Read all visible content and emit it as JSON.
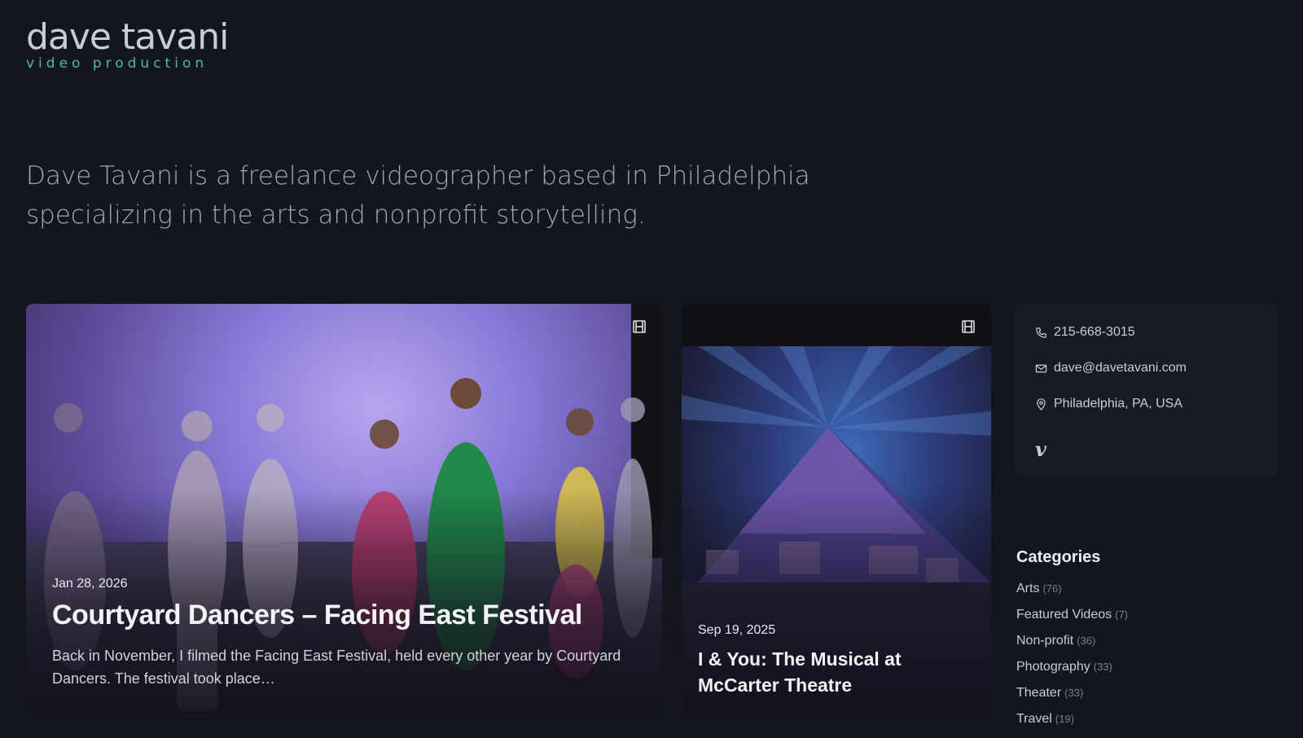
{
  "site": {
    "logo_name": "dave tavani",
    "logo_tagline": "video production"
  },
  "intro": {
    "text": "Dave Tavani is a freelance videographer based in Philadelphia specializing in the arts and nonprofit storytelling."
  },
  "posts": [
    {
      "date": "Jan 28, 2026",
      "title": "Courtyard Dancers – Facing East Festival",
      "excerpt": "Back in November, I filmed the Facing East Festival, held every other year by Courtyard Dancers. The festival took place…",
      "icon": "film-icon"
    },
    {
      "date": "Sep 19, 2025",
      "title": "I & You: The Musical at McCarter Theatre",
      "icon": "film-icon"
    }
  ],
  "contact": {
    "phone": "215-668-3015",
    "email": "dave@davetavani.com",
    "location": "Philadelphia, PA, USA",
    "social_icon": "vimeo-icon",
    "social_glyph": "v"
  },
  "categories": {
    "title": "Categories",
    "items": [
      {
        "label": "Arts",
        "count": "(76)"
      },
      {
        "label": "Featured Videos",
        "count": "(7)"
      },
      {
        "label": "Non-profit",
        "count": "(36)"
      },
      {
        "label": "Photography",
        "count": "(33)"
      },
      {
        "label": "Theater",
        "count": "(33)"
      },
      {
        "label": "Travel",
        "count": "(19)"
      }
    ]
  },
  "colors": {
    "background": "#14161d",
    "accent": "#4fb3b5",
    "panel": "#181b24"
  }
}
